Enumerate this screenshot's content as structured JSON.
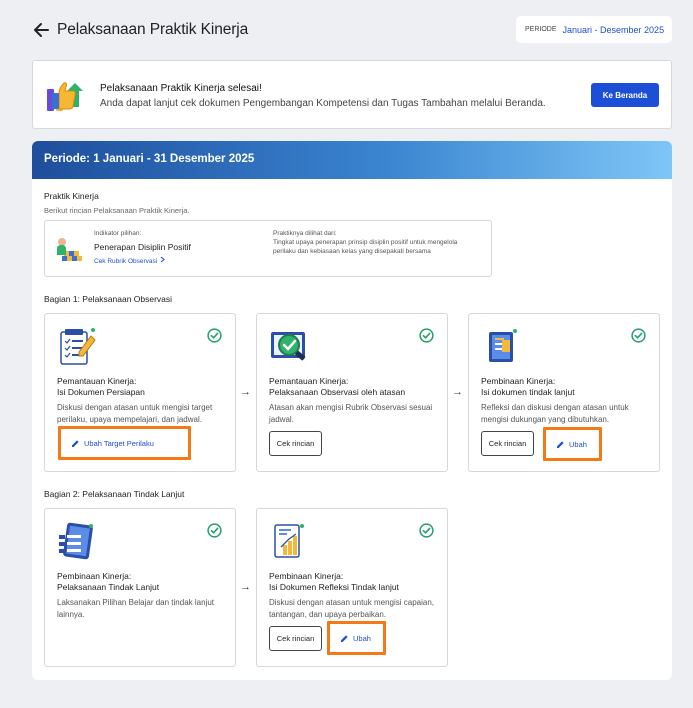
{
  "header": {
    "title": "Pelaksanaan Praktik Kinerja",
    "period_label": "PERIODE",
    "period_value": "Januari - Desember 2025"
  },
  "banner": {
    "title": "Pelaksanaan Praktik Kinerja selesai!",
    "subtitle": "Anda dapat lanjut cek dokumen Pengembangan Kompetensi dan Tugas Tambahan melalui Beranda.",
    "button": "Ke Beranda"
  },
  "main": {
    "period_title": "Periode: 1 Januari - 31 Desember 2025",
    "section_title": "Praktik Kinerja",
    "section_sub": "Berikut rincian Pelaksanaan Praktik Kinerja.",
    "indicator": {
      "label": "Indikator pilihan:",
      "title": "Penerapan Disiplin Positif",
      "link": "Cek Rubrik Observasi",
      "seen_label": "Praktiknya dilihat dari:",
      "seen_text": "Tingkat upaya penerapan prinsip disiplin positif untuk mengelola perilaku dan kebiasaan kelas yang disepakati bersama"
    },
    "part1": {
      "title": "Bagian 1: Pelaksanaan Observasi",
      "cards": [
        {
          "title1": "Pemantauan Kinerja:",
          "title2": "Isi Dokumen Persiapan",
          "desc": "Diskusi dengan atasan untuk mengisi target perilaku, upaya mempelajari, dan jadwal.",
          "edit": "Ubah Target Perilaku"
        },
        {
          "title1": "Pemantauan Kinerja:",
          "title2": "Pelaksanaan Observasi oleh atasan",
          "desc": "Atasan akan mengisi Rubrik Observasi sesuai jadwal.",
          "detail": "Cek rincian"
        },
        {
          "title1": "Pembinaan Kinerja:",
          "title2": "Isi dokumen tindak lanjut",
          "desc": "Refleksi dan diskusi dengan atasan untuk mengisi dukungan yang dibutuhkan.",
          "detail": "Cek rincian",
          "edit": "Ubah"
        }
      ]
    },
    "part2": {
      "title": "Bagian 2: Pelaksanaan Tindak Lanjut",
      "cards": [
        {
          "title1": "Pembinaan Kinerja:",
          "title2": "Pelaksanaan Tindak Lanjut",
          "desc": "Laksanakan Pilihan Belajar dan tindak lanjut lainnya."
        },
        {
          "title1": "Pembinaan Kinerja:",
          "title2": "Isi Dokumen Refleksi Tindak lanjut",
          "desc": "Diskusi dengan atasan untuk mengisi capaian, tantangan, dan upaya perbaikan.",
          "detail": "Cek rincian",
          "edit": "Ubah"
        }
      ]
    },
    "arrow": "→"
  },
  "colors": {
    "primary": "#1d4ed8",
    "highlight": "#f47a18",
    "check": "#22a06b"
  },
  "icons": [
    "arrow-left-icon",
    "thumbs-up-icon",
    "checklist-icon",
    "magnifier-check-icon",
    "notebook-icon",
    "tablet-list-icon",
    "chart-document-icon",
    "check-circle-icon",
    "pencil-icon",
    "chevron-right-icon"
  ]
}
